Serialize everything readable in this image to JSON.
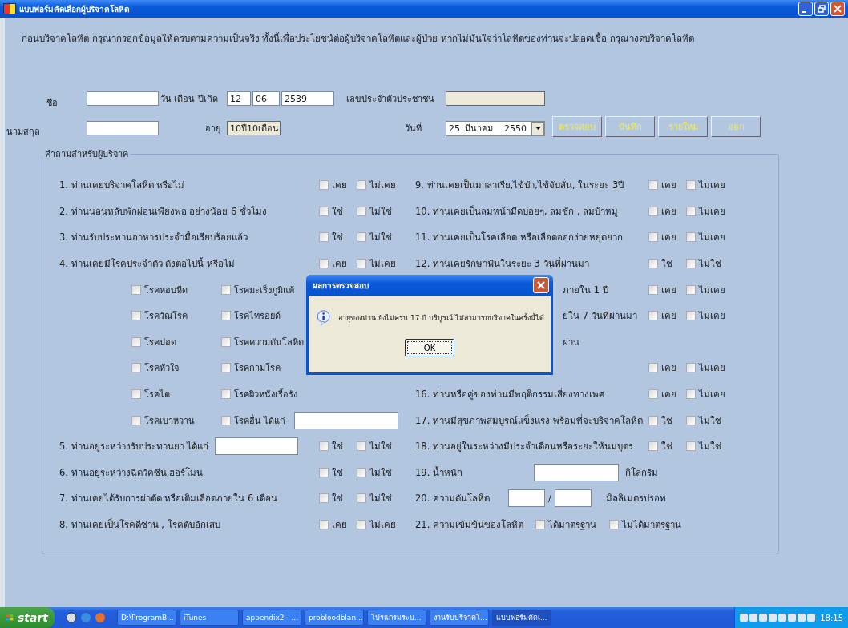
{
  "window": {
    "title": "แบบฟอร์มคัดเลือกผู้บริจาคโลหิต"
  },
  "intro": "ก่อนบริจาคโลหิต กรุณากรอกข้อมูลให้ครบตามความเป็นจริง ทั้งนี้เพื่อประโยชน์ต่อผู้บริจาคโลหิตและผู้ป่วย หากไม่มั่นใจว่าโลหิตของท่านจะปลอดเชื้อ กรุณางดบริจาคโลหิต",
  "personal": {
    "first_name_label": "ชื่อ",
    "last_name_label": "นามสกุล",
    "birth_label": "วัน เดือน ปีเกิด",
    "birth_day": "12",
    "birth_month": "06",
    "birth_year": "2539",
    "id_label": "เลขประจำตัวประชาชน",
    "id_field": {
      "readonly": true
    },
    "age_label": "อายุ",
    "age_field": {
      "value": "10ปี10เดือน",
      "readonly": true
    },
    "date_label": "วันที่",
    "date_day": "25",
    "date_month": "มีนาคม",
    "date_year": "2550"
  },
  "buttons": [
    "ตรวจสอบ",
    "บันทึก",
    "รายใหม่",
    "ออก"
  ],
  "group": {
    "title": "คำถามสำหรับผู้บริจาค",
    "left": [
      {
        "kind": "question",
        "number": "1.",
        "text": "ท่านเคยบริจาคโลหิต หรือไม่",
        "options": [
          {
            "label": "เคย",
            "checked": false
          },
          {
            "label": "ไม่เคย",
            "checked": false
          }
        ]
      },
      {
        "kind": "question",
        "number": "2.",
        "text": "ท่านนอนหลับพักผ่อนเพียงพอ อย่างน้อย 6 ชั่วโมง",
        "options": [
          {
            "label": "ใช่",
            "checked": false
          },
          {
            "label": "ไม่ใช่",
            "checked": false
          }
        ]
      },
      {
        "kind": "question",
        "number": "3.",
        "text": "ท่านรับประทานอาหารประจำมื้อเรียบร้อยแล้ว",
        "options": [
          {
            "label": "ใช่",
            "checked": false
          },
          {
            "label": "ไม่ใช่",
            "checked": false
          }
        ]
      },
      {
        "kind": "question",
        "number": "4.",
        "text": "ท่านเคยมีโรคประจำตัว ดังต่อไปนี้ หรือไม่",
        "options": [
          {
            "label": "เคย",
            "checked": false
          },
          {
            "label": "ไม่เคย",
            "checked": false
          }
        ]
      },
      {
        "kind": "diseases",
        "items": [
          {
            "label": "โรคหอบหืด",
            "checked": false
          },
          {
            "label": "โรคมะเร็งภูมิแพ้",
            "checked": false
          },
          {
            "label": "โรควัณโรค",
            "checked": false
          },
          {
            "label": "โรคไทรอยด์",
            "checked": false
          },
          {
            "label": "โรคปอด",
            "checked": false
          },
          {
            "label": "โรคความดันโลหิต",
            "checked": false
          },
          {
            "label": "โรคหัวใจ",
            "checked": false
          },
          {
            "label": "โรคกามโรค",
            "checked": false
          },
          {
            "label": "โรคไต",
            "checked": false
          },
          {
            "label": "โรคผิวหนังเรื้อรัง",
            "checked": false
          },
          {
            "label": "โรคเบาหวาน",
            "checked": false
          },
          {
            "label": "โรคอื่น ได้แก่",
            "checked": false,
            "kind": "other"
          }
        ]
      },
      {
        "kind": "question-input",
        "number": "5.",
        "text": "ท่านอยู่ระหว่างรับประทานยา ได้แก่",
        "options": [
          {
            "label": "ใช่",
            "checked": false
          },
          {
            "label": "ไม่ใช่",
            "checked": false
          }
        ]
      },
      {
        "kind": "question",
        "number": "6.",
        "text": "ท่านอยู่ระหว่างฉีดวัคซีน,ฮอร์โมน",
        "options": [
          {
            "label": "ใช่",
            "checked": false
          },
          {
            "label": "ไม่ใช่",
            "checked": false
          }
        ]
      },
      {
        "kind": "question",
        "number": "7.",
        "text": "ท่านเคยได้รับการผ่าตัด หรือเติมเลือดภายใน  6 เดือน",
        "options": [
          {
            "label": "ใช่",
            "checked": false
          },
          {
            "label": "ไม่ใช่",
            "checked": false
          }
        ]
      },
      {
        "kind": "question",
        "number": "8.",
        "text": "ท่านเคยเป็นโรคดีซ่าน , โรคตับอักเสบ",
        "options": [
          {
            "label": "เคย",
            "checked": false
          },
          {
            "label": "ไม่เคย",
            "checked": false
          }
        ]
      }
    ],
    "right": [
      {
        "kind": "question",
        "number": "9.",
        "text": "ท่านเคยเป็นมาลาเรีย,ไข้ป่า,ไข้จับสั่น, ในระยะ 3ปี",
        "options": [
          {
            "label": "เคย",
            "checked": false
          },
          {
            "label": "ไม่เคย",
            "checked": false
          }
        ]
      },
      {
        "kind": "question",
        "number": "10.",
        "text": "ท่านเคยเป็นลมหน้ามืดบ่อยๆ, ลมชัก , ลมบ้าหมู",
        "options": [
          {
            "label": "เคย",
            "checked": false
          },
          {
            "label": "ไม่เคย",
            "checked": false
          }
        ]
      },
      {
        "kind": "question",
        "number": "11.",
        "text": "ท่านเคยเป็นโรคเลือด หรือเลือดออกง่ายหยุดยาก",
        "options": [
          {
            "label": "เคย",
            "checked": false
          },
          {
            "label": "ไม่เคย",
            "checked": false
          }
        ]
      },
      {
        "kind": "question",
        "number": "12.",
        "text": "ท่านเคยรักษาฟันในระยะ 3 วันที่ผ่านมา",
        "options": [
          {
            "label": "ใช่",
            "checked": false
          },
          {
            "label": "ไม่ใช่",
            "checked": false
          }
        ]
      },
      {
        "kind": "partial",
        "text": "ภายใน 1 ปี",
        "options": [
          {
            "label": "เคย",
            "checked": false
          },
          {
            "label": "ไม่เคย",
            "checked": false
          }
        ]
      },
      {
        "kind": "partial",
        "text": "ยใน 7 วันที่ผ่านมา",
        "options": [
          {
            "label": "เคย",
            "checked": false
          },
          {
            "label": "ไม่เคย",
            "checked": false
          }
        ]
      },
      {
        "kind": "partial-wrapped",
        "text": "ผ่าน",
        "options": [
          {
            "label": "เคย",
            "checked": false
          },
          {
            "label": "ไม่เคย",
            "checked": false
          }
        ]
      },
      {
        "kind": "question",
        "number": "16.",
        "text": "ท่านหรือคู่ของท่านมีพฤติกรรมเสี่ยงทางเพศ",
        "options": [
          {
            "label": "เคย",
            "checked": false
          },
          {
            "label": "ไม่เคย",
            "checked": false
          }
        ]
      },
      {
        "kind": "question",
        "number": "17.",
        "text": "ท่านมีสุขภาพสมบูรณ์แข็งแรง พร้อมที่จะบริจาคโลหิต",
        "options": [
          {
            "label": "ใช่",
            "checked": false
          },
          {
            "label": "ไม่ใช่",
            "checked": false
          }
        ]
      },
      {
        "kind": "question",
        "number": "18.",
        "text": "ท่านอยู่ในระหว่างมีประจำเดือนหรือระยะให้นมบุตร",
        "options": [
          {
            "label": "ใช่",
            "checked": false
          },
          {
            "label": "ไม่ใช่",
            "checked": false
          }
        ]
      },
      {
        "kind": "weight",
        "number": "19.",
        "text": "น้ำหนัก",
        "unit": "กิโลกรัม"
      },
      {
        "kind": "pressure",
        "number": "20.",
        "text": "ความดันโลหิต",
        "separator": "/",
        "unit": "มิลลิเมตรปรอท"
      },
      {
        "kind": "inline-options",
        "number": "21.",
        "text": "ความเข้มข้นของโลหิต",
        "options": [
          {
            "label": "ได้มาตรฐาน",
            "checked": false
          },
          {
            "label": "ไม่ได้มาตรฐาน",
            "checked": false
          }
        ]
      }
    ]
  },
  "dialog": {
    "title": "ผลการตรวจสอบ",
    "message": "อายุของท่าน ยังไม่ครบ 17 ปี บริบูรณ์ ไม่สามารถบริจาคในครั้งนี้ได้",
    "button": "OK"
  },
  "taskbar": {
    "start": "start",
    "tasks": [
      {
        "label": "D:\\ProgramB...",
        "selected": false
      },
      {
        "label": "iTunes",
        "selected": false
      },
      {
        "label": "appendix2 - ...",
        "selected": false
      },
      {
        "label": "probloodblan...",
        "selected": false
      },
      {
        "label": "โปรแกรมระบ...",
        "selected": false
      },
      {
        "label": "งานรับบริจาคโ...",
        "selected": false
      },
      {
        "label": "แบบฟอร์มคัดเ...",
        "selected": true
      }
    ],
    "clock": "18:15"
  }
}
